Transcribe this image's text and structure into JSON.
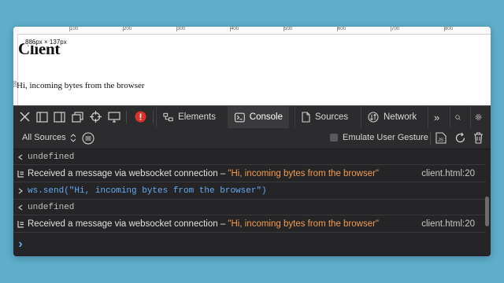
{
  "page": {
    "title": "Client",
    "dimensions_badge": "886px × 137px",
    "paragraph": "Hi, incoming bytes from the browser",
    "ruler_labels": [
      "100",
      "200",
      "300",
      "400",
      "500",
      "600",
      "700",
      "800"
    ],
    "vruler_label": "100"
  },
  "devtools": {
    "tabs": [
      {
        "label": "Elements",
        "icon": "elements-icon"
      },
      {
        "label": "Console",
        "icon": "console-icon"
      },
      {
        "label": "Sources",
        "icon": "sources-icon"
      },
      {
        "label": "Network",
        "icon": "network-icon"
      }
    ],
    "more_tabs": "»",
    "filter": {
      "sources_label": "All Sources",
      "emulate_label": "Emulate User Gesture"
    },
    "console": {
      "rows": [
        {
          "kind": "result",
          "text": "undefined"
        },
        {
          "kind": "log",
          "text": "Received a message via websocket connection – ",
          "quote": "\"Hi, incoming bytes from the browser\"",
          "source": "client.html:20"
        },
        {
          "kind": "input",
          "text": "ws.send(\"Hi, incoming bytes from the browser\")"
        },
        {
          "kind": "result",
          "text": "undefined"
        },
        {
          "kind": "log",
          "text": "Received a message via websocket connection – ",
          "quote": "\"Hi, incoming bytes from the browser\"",
          "source": "client.html:20"
        }
      ],
      "prompt": "›"
    }
  },
  "colors": {
    "background": "#5eaecb",
    "error_badge": "#d9322b",
    "string_orange": "#f29b50",
    "prompt_blue": "#65a9f3"
  }
}
